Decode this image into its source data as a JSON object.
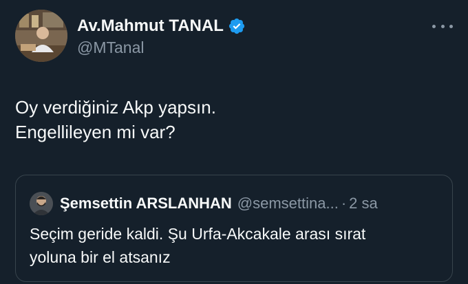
{
  "author": {
    "display_name": "Av.Mahmut TANAL",
    "handle": "@MTanal",
    "verified_icon": "verified-badge-icon",
    "avatar": "profile-photo"
  },
  "menu": {
    "icon": "more-options-icon"
  },
  "tweet": {
    "lines": [
      "Oy verdiğiniz Akp yapsın.",
      "Engellileyen mi var?"
    ]
  },
  "quoted_tweet": {
    "display_name": "Şemsettin ARSLANHAN",
    "handle": "@semsettina...",
    "separator": "·",
    "time": "2 sa",
    "lines": [
      "Seçim geride kaldi. Şu Urfa-Akcakale arası sırat",
      "yoluna bir el atsanız"
    ]
  },
  "colors": {
    "background": "#15202b",
    "text": "#f7f9f9",
    "secondary": "#8b98a5",
    "border": "#38444d",
    "verified": "#1d9bf0"
  }
}
